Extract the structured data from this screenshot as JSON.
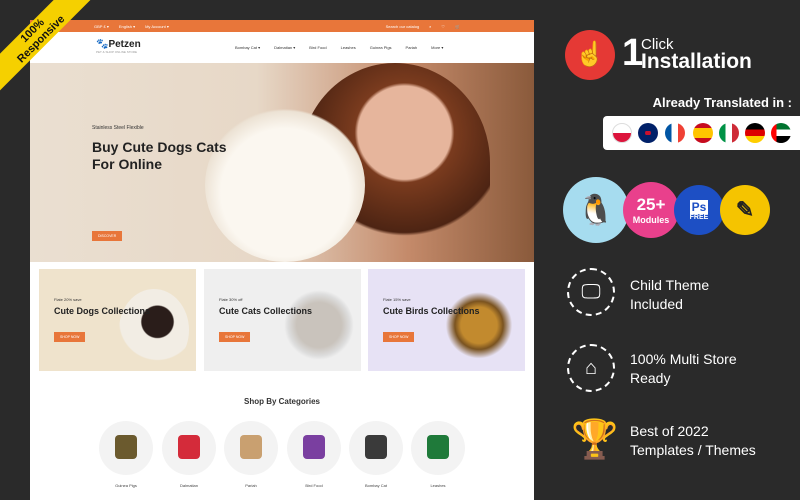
{
  "ribbon": {
    "line1": "100%",
    "line2": "Responsive"
  },
  "store": {
    "topbar": {
      "currency": "GBP £ ▾",
      "language": "English ▾",
      "account": "My Account ▾",
      "search_placeholder": "Search our catalog"
    },
    "logo": {
      "name": "Petzen",
      "tagline": "PET & SHOP ONLINE STORE"
    },
    "nav": [
      "Bombay Cat ▾",
      "Dalmatian ▾",
      "Bird Food",
      "Leashes",
      "Guinea Pigs",
      "Pariah",
      "More ▾"
    ],
    "hero": {
      "subtitle": "Stainless Steel Flexible",
      "title": "Buy Cute Dogs Cats For Online",
      "button": "DISCOVER"
    },
    "banners": [
      {
        "offer": "Flate 20% save",
        "title": "Cute Dogs Collections",
        "button": "SHOP NOW",
        "bg": "#efe3cc"
      },
      {
        "offer": "Flate 30% off",
        "title": "Cute Cats Collections",
        "button": "SHOP NOW",
        "bg": "#efefef"
      },
      {
        "offer": "Flate 15% save",
        "title": "Cute Birds Collections",
        "button": "SHOP NOW",
        "bg": "#e7e2f5"
      }
    ],
    "categories_title": "Shop By Categories",
    "categories": [
      "Guinea Pigs",
      "Dalmatian",
      "Pariah",
      "Bird Food",
      "Bombay Cat",
      "Leashes"
    ]
  },
  "promo": {
    "install_number": "1",
    "install_line1": "Click",
    "install_line2": "Installation",
    "translated": "Already Translated in :",
    "flags": [
      "poland",
      "uk",
      "france",
      "spain",
      "italy",
      "germany",
      "uae"
    ],
    "modules_count": "25+",
    "modules_label": "Modules",
    "ps_label": "Ps",
    "ps_free": "FREE",
    "features": [
      {
        "line1": "Child Theme",
        "line2": "Included",
        "icon": "monitor-icon"
      },
      {
        "line1": "100% Multi Store",
        "line2": "Ready",
        "icon": "store-icon"
      },
      {
        "line1": "Best of 2022",
        "line2": "Templates / Themes",
        "icon": "trophy-icon"
      }
    ]
  },
  "colors": {
    "accent": "#e8763a",
    "background": "#2a2a2a",
    "ribbon": "#f5d000"
  }
}
